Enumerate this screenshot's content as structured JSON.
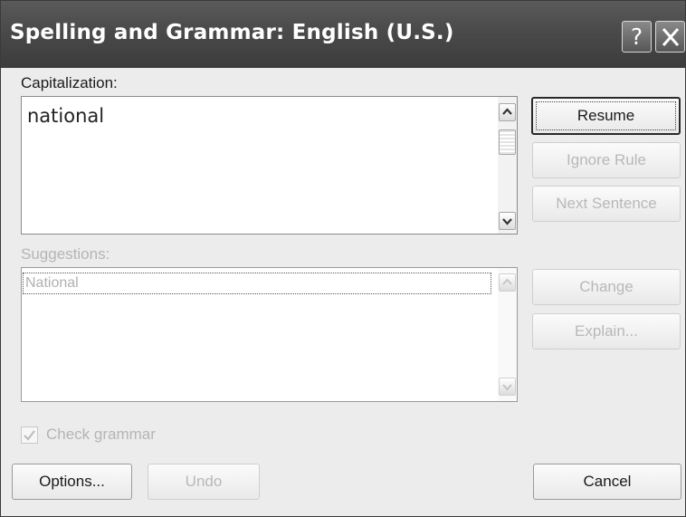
{
  "window": {
    "title": "Spelling and Grammar: English (U.S.)",
    "help_glyph": "?",
    "close_icon": "close-icon"
  },
  "issue": {
    "label": "Capitalization:",
    "text": "national"
  },
  "suggestions": {
    "label": "Suggestions:",
    "items": [
      "National"
    ],
    "enabled": false
  },
  "check_grammar": {
    "label": "Check grammar",
    "checked": true,
    "enabled": false
  },
  "buttons": {
    "resume": "Resume",
    "ignore_rule": "Ignore Rule",
    "next_sentence": "Next Sentence",
    "change": "Change",
    "explain": "Explain...",
    "options": "Options...",
    "undo": "Undo",
    "cancel": "Cancel"
  }
}
